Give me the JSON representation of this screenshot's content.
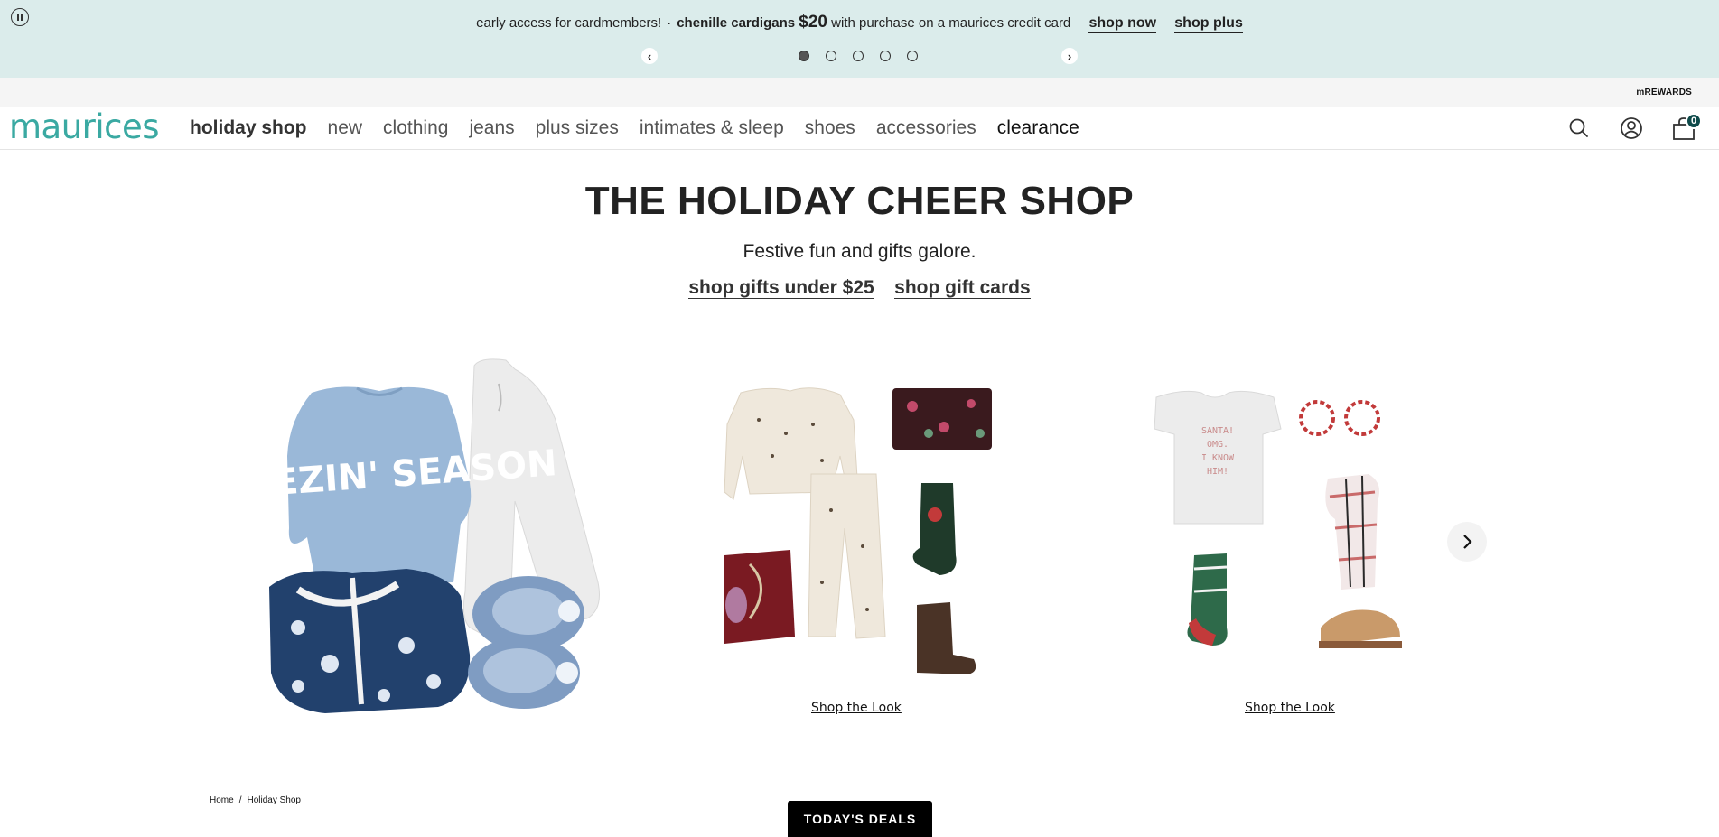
{
  "promo": {
    "lead": "early access for cardmembers!",
    "separator": "·",
    "product": "chenille cardigans",
    "price": "$20",
    "tail": "with purchase on a maurices credit card",
    "link_shop_now": "shop now",
    "link_shop_plus": "shop plus",
    "prev_glyph": "‹",
    "next_glyph": "›",
    "slide_count": 5,
    "active_slide": 1
  },
  "utility": {
    "rewards": "mREWARDS"
  },
  "nav": {
    "logo": "maurices",
    "items": [
      {
        "label": "holiday shop"
      },
      {
        "label": "new"
      },
      {
        "label": "clothing"
      },
      {
        "label": "jeans"
      },
      {
        "label": "plus sizes"
      },
      {
        "label": "intimates & sleep"
      },
      {
        "label": "shoes"
      },
      {
        "label": "accessories"
      },
      {
        "label": "clearance"
      }
    ],
    "cart_count": "0",
    "icons": [
      "search-icon",
      "account-icon",
      "shopping-bag-icon"
    ]
  },
  "hero": {
    "title": "THE HOLIDAY CHEER SHOP",
    "subtitle": "Festive fun and gifts galore.",
    "link_gifts": "shop gifts under $25",
    "link_cards": "shop gift cards"
  },
  "looks": [
    {
      "print": "FREEZIN' SEASON"
    },
    {
      "link": "Shop the Look"
    },
    {
      "link": "Shop the Look",
      "tee_text": [
        "SANTA!",
        "OMG.",
        "I KNOW",
        "HIM!"
      ]
    }
  ],
  "breadcrumb": {
    "home": "Home",
    "separator": "/",
    "current": "Holiday Shop"
  },
  "deals_button": "TODAY'S DEALS",
  "colors": {
    "banner": "#dbeceb",
    "brand_teal": "#3aa9a2",
    "badge": "#0e4a4a"
  }
}
